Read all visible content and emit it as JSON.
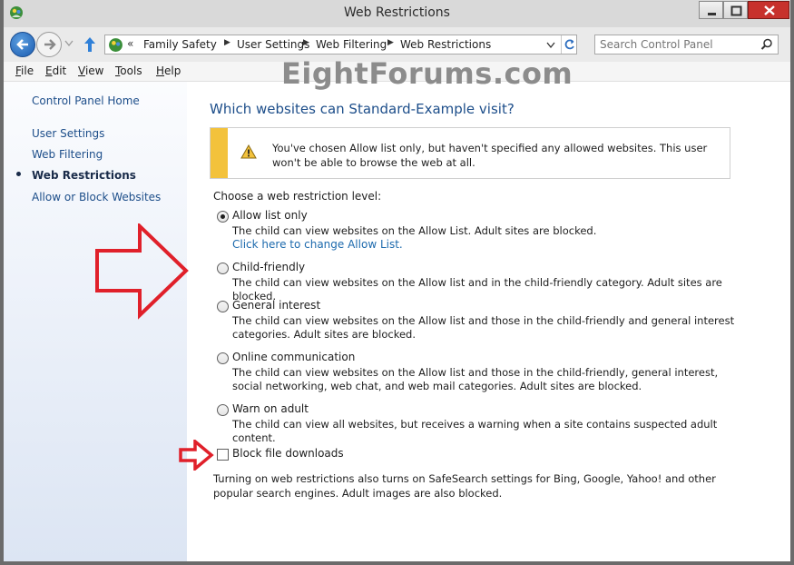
{
  "window": {
    "title": "Web Restrictions",
    "accent_close": "#c7312c"
  },
  "nav": {
    "breadcrumbs": [
      "Family Safety",
      "User Settings",
      "Web Filtering",
      "Web Restrictions"
    ],
    "overflow": "«",
    "search_placeholder": "Search Control Panel"
  },
  "menu": {
    "items": [
      {
        "key": "F",
        "rest": "ile"
      },
      {
        "key": "E",
        "rest": "dit"
      },
      {
        "key": "V",
        "rest": "iew"
      },
      {
        "key": "T",
        "rest": "ools"
      },
      {
        "key": "H",
        "rest": "elp"
      }
    ]
  },
  "watermark": "EightForums.com",
  "sidebar": {
    "home": "Control Panel Home",
    "items": [
      {
        "label": "User Settings",
        "active": false
      },
      {
        "label": "Web Filtering",
        "active": false
      },
      {
        "label": "Web Restrictions",
        "active": true
      },
      {
        "label": "Allow or Block Websites",
        "active": false
      }
    ]
  },
  "main": {
    "heading": "Which websites can Standard-Example visit?",
    "warning": "You've chosen Allow list only, but haven't specified any allowed websites. This user won't be able to browse the web at all.",
    "choose_label": "Choose a web restriction level:",
    "options": [
      {
        "label": "Allow list only",
        "desc": "The child can view websites on the Allow List. Adult sites are blocked.",
        "selected": true,
        "link": "Click here to change Allow List."
      },
      {
        "label": "Child-friendly",
        "desc": "The child can view websites on the Allow list and in the child-friendly category. Adult sites are blocked.",
        "selected": false
      },
      {
        "label": "General interest",
        "desc": "The child can view websites on the Allow list and those in the child-friendly and general interest categories. Adult sites are blocked.",
        "selected": false
      },
      {
        "label": "Online communication",
        "desc": "The child can view websites on the Allow list and those in the child-friendly, general interest, social networking, web chat, and web mail categories. Adult sites are blocked.",
        "selected": false
      },
      {
        "label": "Warn on adult",
        "desc": "The child can view all websites, but receives a warning when a site contains suspected adult content.",
        "selected": false
      }
    ],
    "block_downloads": {
      "label": "Block file downloads",
      "checked": false
    },
    "footer": "Turning on web restrictions also turns on SafeSearch settings for Bing, Google, Yahoo! and other popular search engines. Adult images are also blocked."
  },
  "annotation_color": "#e0202a"
}
